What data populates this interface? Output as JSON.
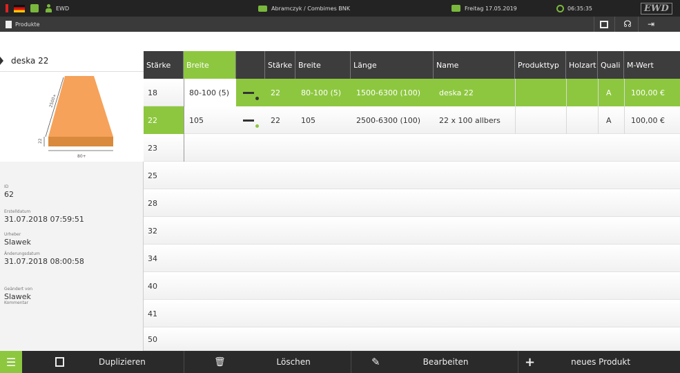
{
  "topbar": {
    "user": "EWD",
    "company": "Abramczyk / Combimes BNK",
    "date": "Freitag  17.05.2019",
    "time": "06:35:35",
    "logo": "EWD"
  },
  "subbar": {
    "section": "Produkte"
  },
  "product": {
    "name": "deska 22",
    "drawing_length": "2500+",
    "drawing_thickness": "22",
    "drawing_width": "80+"
  },
  "info": [
    {
      "label": "ID",
      "value": "62"
    },
    {
      "label": "Erstelldatum",
      "value": "31.07.2018 07:59:51"
    },
    {
      "label": "Urheber",
      "value": "Slawek"
    },
    {
      "label": "Änderungsdatum",
      "value": "31.07.2018 08:00:58"
    },
    {
      "label": "Geändert von",
      "value": "Slawek"
    },
    {
      "label": "Kommentar",
      "value": ""
    }
  ],
  "staerke_header": "Stärke",
  "staerke_list": [
    "18",
    "22",
    "23",
    "25",
    "28",
    "32",
    "34",
    "40",
    "41",
    "50"
  ],
  "breite_header": "Breite",
  "breite_list": [
    "80-100 (5)",
    "105"
  ],
  "columns": [
    "Stärke",
    "Breite",
    "Länge",
    "Name",
    "Produkttyp",
    "Holzart",
    "Quali",
    "M-Wert"
  ],
  "rows": [
    {
      "staerke": "22",
      "breite": "80-100 (5)",
      "laenge": "1500-6300 (100)",
      "name": "deska 22",
      "produkttyp": "",
      "holzart": "",
      "quali": "A",
      "mwert": "100,00 €"
    },
    {
      "staerke": "22",
      "breite": "105",
      "laenge": "2500-6300 (100)",
      "name": "22 x 100 allbers",
      "produkttyp": "",
      "holzart": "",
      "quali": "A",
      "mwert": "100,00 €"
    }
  ],
  "toolbar": {
    "duplicate": "Duplizieren",
    "delete": "Löschen",
    "edit": "Bearbeiten",
    "new": "neues Produkt"
  },
  "colors": {
    "accent_green": "#8dc73f",
    "dark": "#2a2a2a"
  }
}
